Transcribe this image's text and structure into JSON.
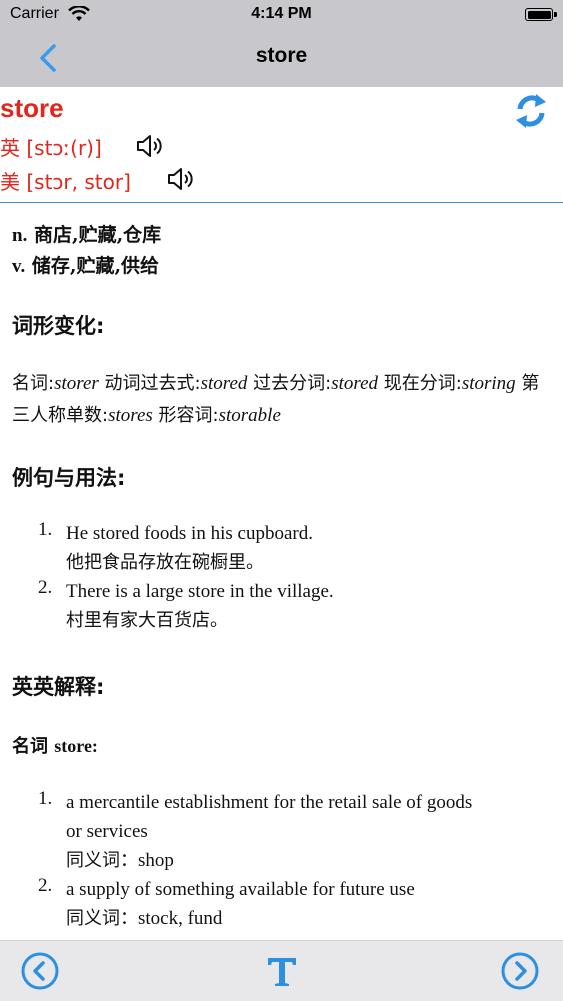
{
  "status": {
    "carrier": "Carrier",
    "time": "4:14 PM"
  },
  "nav": {
    "title": "store"
  },
  "header": {
    "word": "store",
    "uk_label": "英",
    "uk_phonetic": "[stɔː(r)]",
    "us_label": "美",
    "us_phonetic": "[stɔr, stor]"
  },
  "definitions": [
    {
      "pos": "n.",
      "text": "商店,贮藏,仓库"
    },
    {
      "pos": "v.",
      "text": "储存,贮藏,供给"
    }
  ],
  "forms_section": {
    "title": "词形变化:",
    "items": [
      {
        "label": "名词:",
        "value": "storer"
      },
      {
        "label": "动词过去式:",
        "value": "stored"
      },
      {
        "label": "过去分词:",
        "value": "stored"
      },
      {
        "label": "现在分词:",
        "value": "storing"
      },
      {
        "label": "第三人称单数:",
        "value": "stores"
      },
      {
        "label": "形容词:",
        "value": "storable"
      }
    ]
  },
  "examples_section": {
    "title": "例句与用法:",
    "items": [
      {
        "num": "1.",
        "en": "He stored foods in his cupboard.",
        "zh": "他把食品存放在碗橱里。"
      },
      {
        "num": "2.",
        "en": "There is a large store in the village.",
        "zh": "村里有家大百货店。"
      }
    ]
  },
  "english_section": {
    "title": "英英解释:",
    "subtitle_cn": "名词",
    "subtitle_en": "store:",
    "syn_label": "同义词：",
    "items": [
      {
        "num": "1.",
        "line1": "a mercantile establishment for the retail sale of goods",
        "line2": "or services",
        "synonyms": "shop"
      },
      {
        "num": "2.",
        "line1": "a supply of something available for future use",
        "line2": "",
        "synonyms": "stock, fund"
      }
    ]
  },
  "colors": {
    "word_red": "#e1261c",
    "accent_blue": "#2d8fe0",
    "bar_gray": "#c8c8cc"
  }
}
